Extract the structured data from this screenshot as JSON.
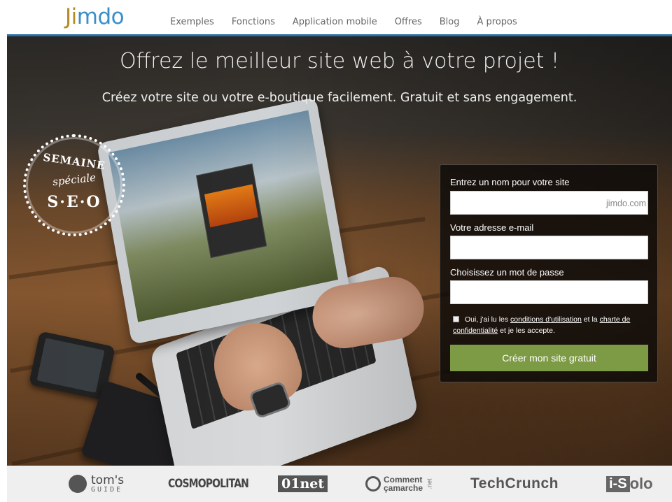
{
  "header": {
    "logo": "Jimdo",
    "nav": [
      "Exemples",
      "Fonctions",
      "Application mobile",
      "Offres",
      "Blog",
      "À propos"
    ]
  },
  "hero": {
    "headline": "Offrez le meilleur site web à votre projet !",
    "subline": "Créez votre site ou votre e-boutique facilement. Gratuit et sans engagement.",
    "badge": {
      "line1": "SEMAINE",
      "line2": "spéciale",
      "line3": "S·E·O"
    }
  },
  "form": {
    "site_label": "Entrez un nom pour votre site",
    "site_value": "",
    "site_suffix": "jimdo.com",
    "email_label": "Votre adresse e-mail",
    "email_value": "",
    "password_label": "Choisissez un mot de passe",
    "password_value": "",
    "terms_prefix": "Oui, j'ai lu les",
    "terms_link": "conditions d'utilisation",
    "terms_middle": "et la",
    "privacy_link": "charte de confidentialité",
    "terms_suffix": "et je les accepte.",
    "submit_label": "Créer mon site gratuit"
  },
  "press": {
    "toms": {
      "line1": "tom's",
      "line2": "GUIDE"
    },
    "cosmo": "COSMOPOLITAN",
    "onenet": "01net",
    "ccm": {
      "line1": "Comment",
      "line2": "çamarche",
      "net": ".net"
    },
    "techcrunch": "TechCrunch",
    "isolo": {
      "i": "i-S",
      "solo": "olo"
    }
  },
  "colors": {
    "accent": "#2a6fa3",
    "button": "#7d9a44",
    "logo_blue": "#3b8fc7",
    "logo_gold": "#b58b25"
  }
}
